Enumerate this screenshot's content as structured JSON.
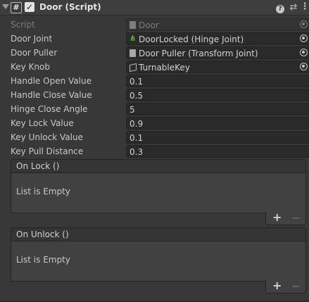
{
  "header": {
    "title": "Door (Script)",
    "enabled": true,
    "check_glyph": "✓",
    "script_glyph": "#",
    "help_glyph": "?",
    "presets_glyph": "⇄",
    "menu_glyph": "⋮"
  },
  "fields": [
    {
      "label": "Script",
      "value": "Door",
      "kind": "object",
      "icon": "script-asset-icon",
      "disabled": true
    },
    {
      "label": "Door Joint",
      "value": "DoorLocked (Hinge Joint)",
      "kind": "object",
      "icon": "hinge-joint-icon",
      "disabled": false
    },
    {
      "label": "Door Puller",
      "value": "Door Puller (Transform Joint)",
      "kind": "object",
      "icon": "script-asset-icon",
      "disabled": false
    },
    {
      "label": "Key Knob",
      "value": "TurnableKey",
      "kind": "object",
      "icon": "gameobject-cube-icon",
      "disabled": false
    },
    {
      "label": "Handle Open Value",
      "value": "0.1",
      "kind": "number"
    },
    {
      "label": "Handle Close Value",
      "value": "0.5",
      "kind": "number"
    },
    {
      "label": "Hinge Close Angle",
      "value": "5",
      "kind": "number"
    },
    {
      "label": "Key Lock Value",
      "value": "0.9",
      "kind": "number"
    },
    {
      "label": "Key Unlock Value",
      "value": "0.1",
      "kind": "number"
    },
    {
      "label": "Key Pull Distance",
      "value": "0.3",
      "kind": "number"
    }
  ],
  "events": [
    {
      "title": "On Lock ()",
      "empty_text": "List is Empty",
      "add_label": "+",
      "remove_label": "−"
    },
    {
      "title": "On Unlock ()",
      "empty_text": "List is Empty",
      "add_label": "+",
      "remove_label": "−"
    }
  ],
  "colors": {
    "background": "#383838",
    "field_bg": "#2a2a2a",
    "hinge_icon": "#8fd15a"
  }
}
